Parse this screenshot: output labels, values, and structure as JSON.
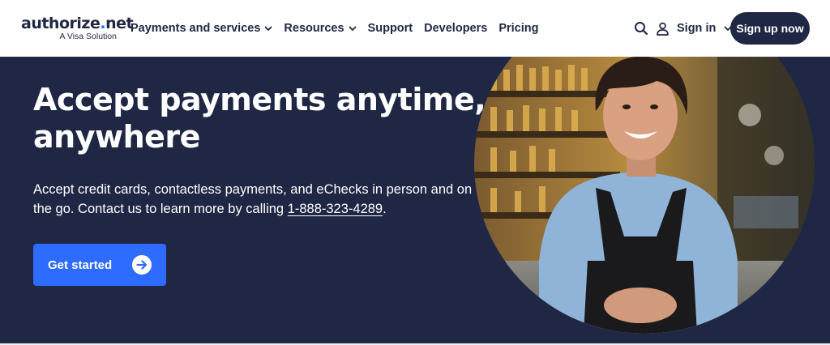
{
  "brand": {
    "name_part1": "authorize",
    "name_dot": ".",
    "name_part2": "net",
    "tagline": "A Visa Solution"
  },
  "nav": {
    "items": [
      {
        "label": "Payments and services",
        "has_dropdown": true
      },
      {
        "label": "Resources",
        "has_dropdown": true
      },
      {
        "label": "Support",
        "has_dropdown": false
      },
      {
        "label": "Developers",
        "has_dropdown": false
      },
      {
        "label": "Pricing",
        "has_dropdown": false
      }
    ],
    "search_icon": "search-icon",
    "signin_label": "Sign in",
    "signup_label": "Sign up now"
  },
  "hero": {
    "title_line1": "Accept payments anytime,",
    "title_line2": "anywhere",
    "description_prefix": "Accept credit cards, contactless payments, and eChecks in person and on the go. Contact us to learn more by calling ",
    "phone": "1-888-323-4289",
    "description_suffix": ".",
    "cta_label": "Get started",
    "cta_icon": "arrow-right-circle-icon"
  },
  "colors": {
    "navy": "#1f2744",
    "accent_blue": "#2e6bff",
    "white": "#ffffff"
  }
}
